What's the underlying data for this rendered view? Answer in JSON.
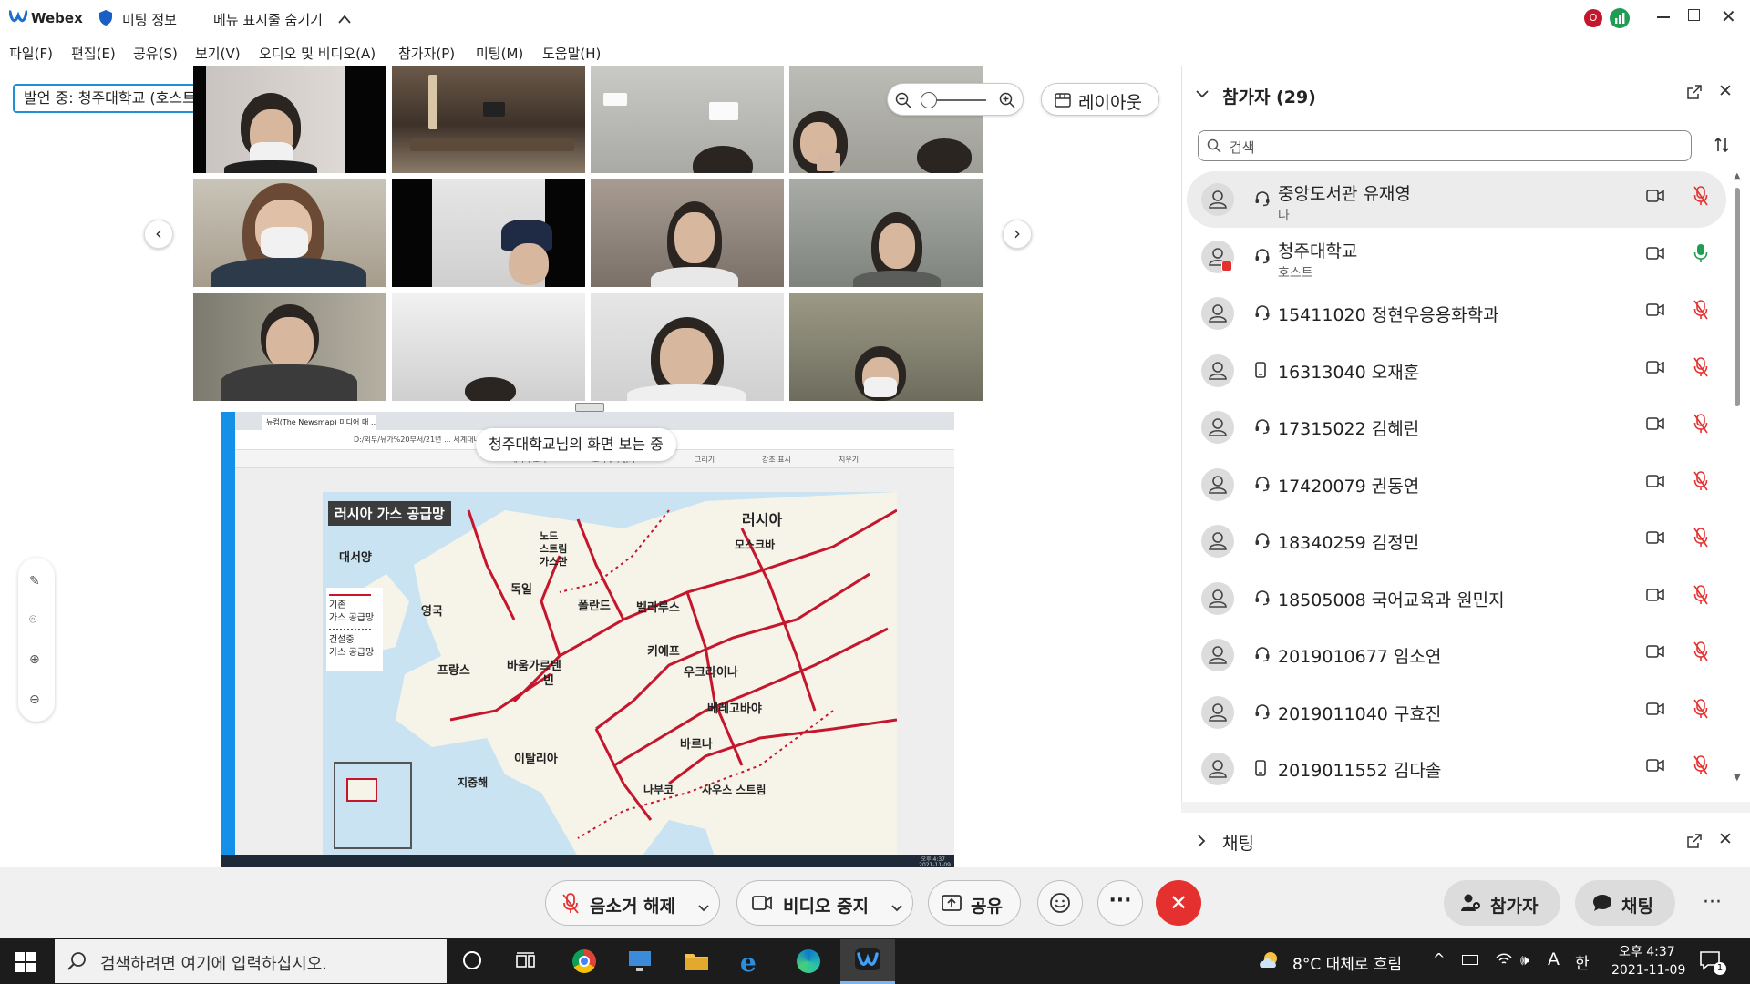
{
  "titlebar": {
    "app_name": "Webex",
    "meeting_info": "미팅 정보",
    "hide_menu": "메뉴 표시줄 숨기기",
    "avatar_letter": "O"
  },
  "menu": [
    "파일(F)",
    "편집(E)",
    "공유(S)",
    "보기(V)",
    "오디오 및 비디오(A)",
    "참가자(P)",
    "미팅(M)",
    "도움말(H)"
  ],
  "stage": {
    "speaking_label": "발언 중: 청주대학교 (호스트)",
    "layout_button": "레이아웃",
    "viewing_banner": "청주대학교님의 화면 보는 중"
  },
  "shared_screen": {
    "browser_tab": "뉴컴(The Newsmap) 미디어 매 …",
    "browser_address": "D:/외부/뮤가%20부서/21년 … 세계대나%20재능기부%20관련/뉴옛…",
    "pdf_tools": [
      "페이지 보기",
      "소리내어 읽기",
      "그리기",
      "강조 표시",
      "지우기"
    ],
    "map_title": "러시아 가스 공급망",
    "legend": {
      "existing": "기존\n가스 공급망",
      "construction": "건설중\n가스 공급망"
    },
    "labels": [
      "러시아",
      "모스크바",
      "대서양",
      "노드\n스트림\n가스관",
      "독일",
      "영국",
      "폴란드",
      "벨라루스",
      "키예프",
      "프랑스",
      "바움가르텐",
      "빈",
      "우크라이나",
      "베레고바야",
      "바르나",
      "이탈리아",
      "지중해",
      "나부코",
      "사우스 스트림"
    ],
    "taskbar_time": "오후 4:37",
    "taskbar_date": "2021-11-09"
  },
  "panel": {
    "participants_header": "참가자 (29)",
    "search_placeholder": "검색",
    "chat_header": "채팅",
    "participants": [
      {
        "name": "중앙도서관 유재영",
        "sub": "나",
        "audio": "headset",
        "mic": "muted",
        "selected": true,
        "host": false
      },
      {
        "name": "청주대학교",
        "sub": "호스트",
        "audio": "headset",
        "mic": "on",
        "selected": false,
        "host": true
      },
      {
        "name": "15411020 정현우응용화학과",
        "sub": "",
        "audio": "headset",
        "mic": "muted"
      },
      {
        "name": "16313040 오재훈",
        "sub": "",
        "audio": "phone",
        "mic": "muted"
      },
      {
        "name": "17315022 김혜린",
        "sub": "",
        "audio": "headset",
        "mic": "muted"
      },
      {
        "name": "17420079 권동연",
        "sub": "",
        "audio": "headset",
        "mic": "muted"
      },
      {
        "name": "18340259 김정민",
        "sub": "",
        "audio": "headset",
        "mic": "muted"
      },
      {
        "name": "18505008 국어교육과 원민지",
        "sub": "",
        "audio": "headset",
        "mic": "muted"
      },
      {
        "name": "2019010677 임소연",
        "sub": "",
        "audio": "headset",
        "mic": "muted"
      },
      {
        "name": "2019011040 구효진",
        "sub": "",
        "audio": "headset",
        "mic": "muted"
      },
      {
        "name": "2019011552 김다솔",
        "sub": "",
        "audio": "phone",
        "mic": "muted"
      }
    ]
  },
  "controls": {
    "unmute": "음소거 해제",
    "stop_video": "비디오 중지",
    "share": "공유",
    "participants": "참가자",
    "chat": "채팅"
  },
  "taskbar": {
    "search_placeholder": "검색하려면 여기에 입력하십시오.",
    "weather": "8°C 대체로 흐림",
    "ime": "A",
    "lang": "한",
    "time": "오후 4:37",
    "date": "2021-11-09",
    "notification_count": "1"
  },
  "colors": {
    "accent_red": "#e4312f",
    "pipeline_red": "#c4162c",
    "panel_sel": "#ececec",
    "taskbar": "#1c1c1c"
  }
}
